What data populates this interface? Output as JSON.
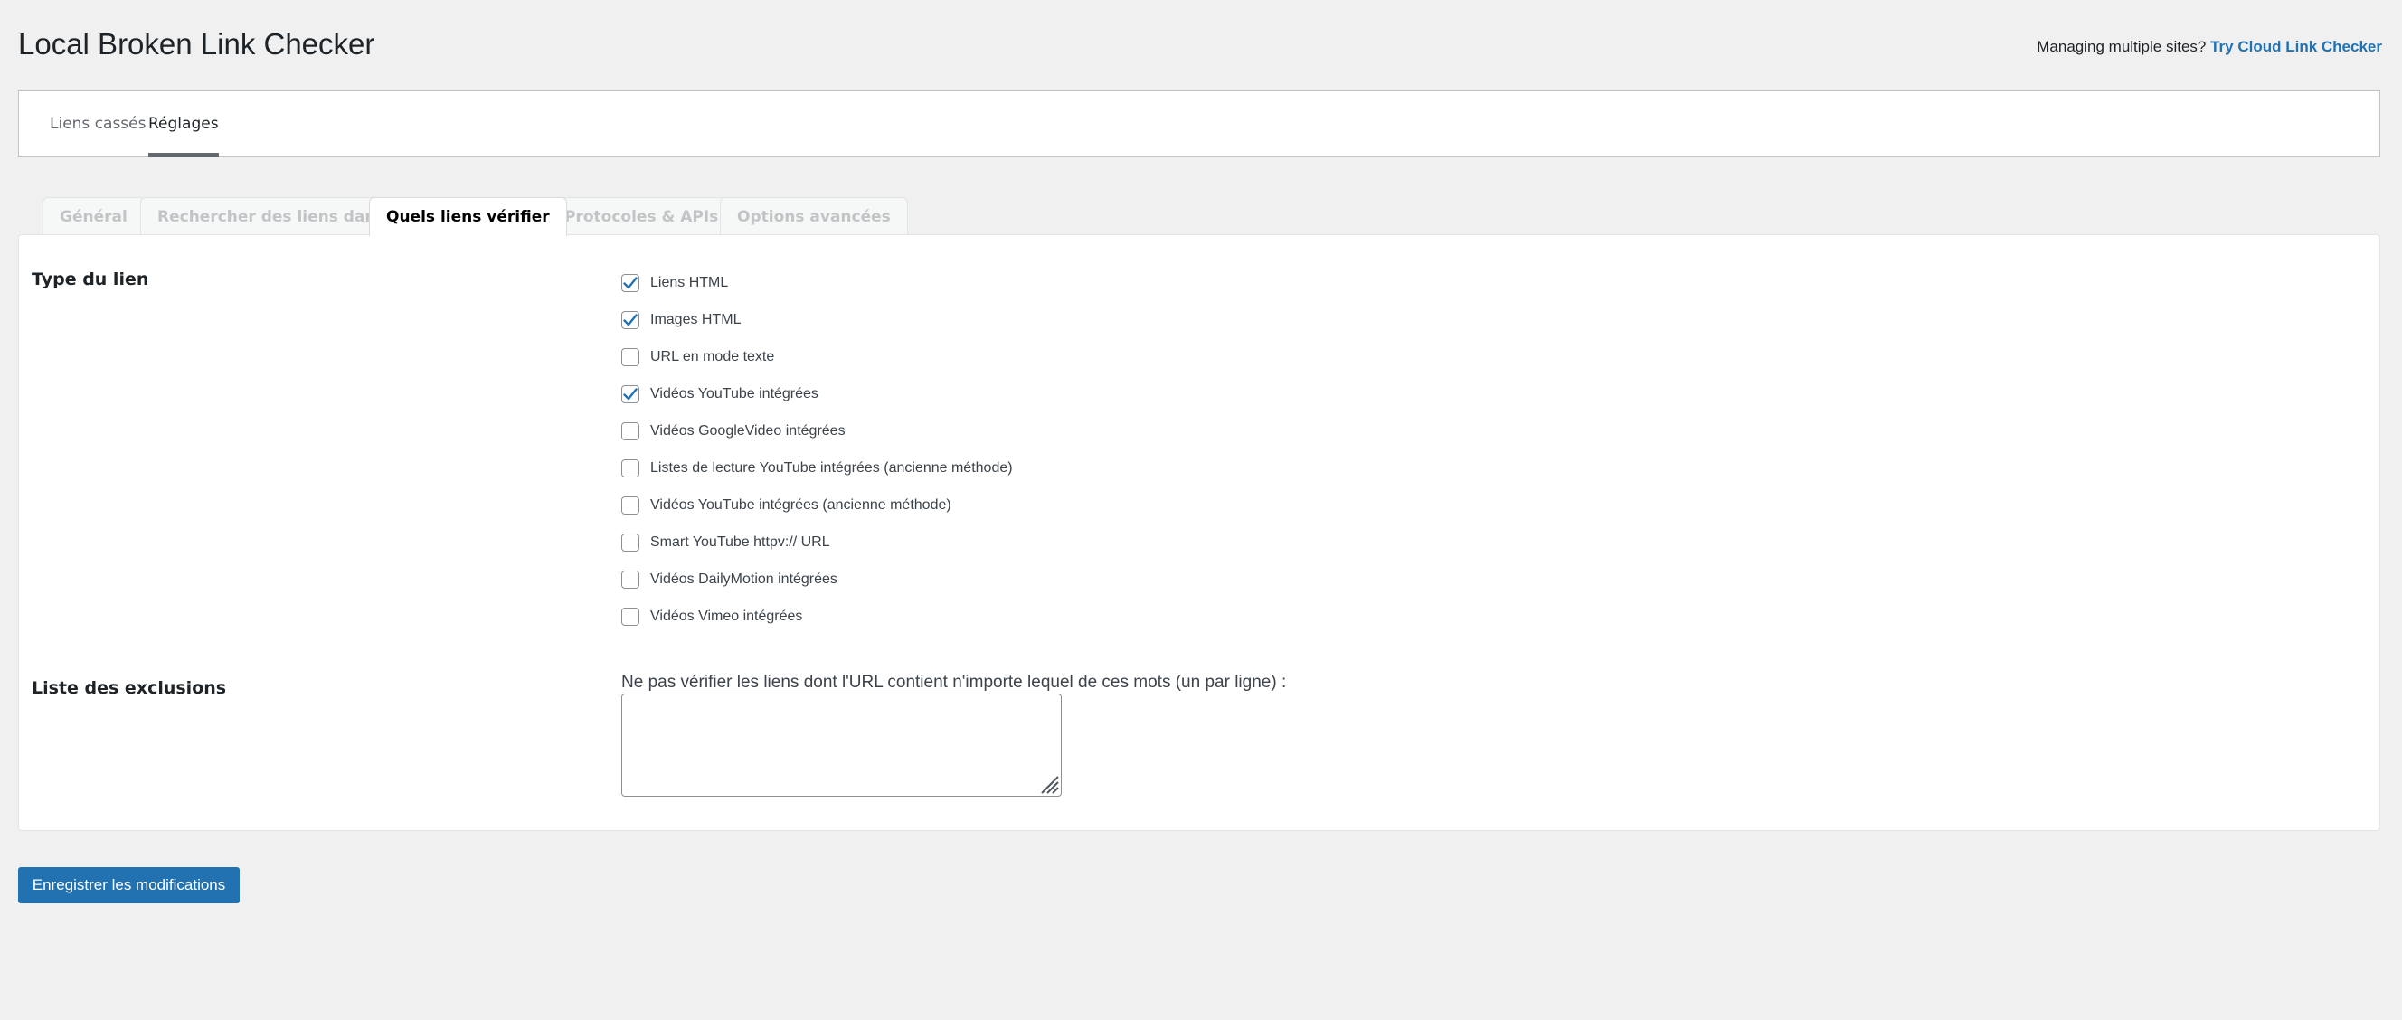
{
  "header": {
    "title": "Local Broken Link Checker",
    "promo_text": "Managing multiple sites?",
    "promo_link": "Try Cloud Link Checker"
  },
  "nav": {
    "items": [
      {
        "label": "Liens cassés",
        "active": false
      },
      {
        "label": "Réglages",
        "active": true
      }
    ]
  },
  "tabs": [
    {
      "label": "Général",
      "active": false
    },
    {
      "label": "Rechercher des liens dans",
      "active": false
    },
    {
      "label": "Quels liens vérifier",
      "active": true
    },
    {
      "label": "Protocoles & APIs",
      "active": false
    },
    {
      "label": "Options avancées",
      "active": false
    }
  ],
  "link_type": {
    "label": "Type du lien",
    "options": [
      {
        "label": "Liens HTML",
        "checked": true
      },
      {
        "label": "Images HTML",
        "checked": true
      },
      {
        "label": "URL en mode texte",
        "checked": false
      },
      {
        "label": "Vidéos YouTube intégrées",
        "checked": true
      },
      {
        "label": "Vidéos GoogleVideo intégrées",
        "checked": false
      },
      {
        "label": "Listes de lecture YouTube intégrées (ancienne méthode)",
        "checked": false
      },
      {
        "label": "Vidéos YouTube intégrées (ancienne méthode)",
        "checked": false
      },
      {
        "label": "Smart YouTube httpv:// URL",
        "checked": false
      },
      {
        "label": "Vidéos DailyMotion intégrées",
        "checked": false
      },
      {
        "label": "Vidéos Vimeo intégrées",
        "checked": false
      }
    ]
  },
  "exclusions": {
    "label": "Liste des exclusions",
    "description": "Ne pas vérifier les liens dont l'URL contient n'importe lequel de ces mots (un par ligne) :",
    "value": ""
  },
  "save_button": "Enregistrer les modifications",
  "colors": {
    "accent": "#2271b1",
    "background": "#f0f0f1",
    "checkmark": "#2271b1"
  }
}
